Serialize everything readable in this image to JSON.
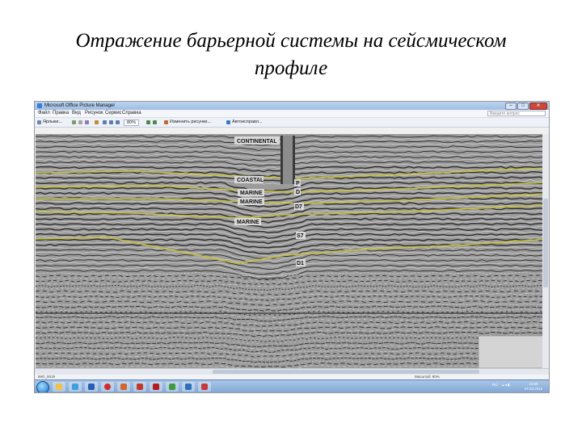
{
  "slide": {
    "title_line1": "Отражение барьерной системы на сейсмическом",
    "title_line2": "профиле"
  },
  "window": {
    "title": "Microsoft Office Picture Manager",
    "min": "–",
    "max": "□",
    "close": "✕"
  },
  "menu": {
    "items": [
      "Файл",
      "Правка",
      "Вид",
      "Рисунок",
      "Сервис",
      "Справка"
    ],
    "search_placeholder": "Введите вопрос"
  },
  "toolbar": {
    "shortcuts": "Ярлыки...",
    "zoom": "80%",
    "edit_pictures": "Изменить рисунки...",
    "autocorrect": "Автоисправл..."
  },
  "seismic": {
    "labels": {
      "continental": "CONTINENTAL",
      "coastal": "COASTAL",
      "marine1": "MARINE",
      "marine2": "MARINE",
      "marine3": "MARINE",
      "p": "P",
      "d": "D",
      "d7": "D7",
      "s7": "S7",
      "d1": "D1"
    },
    "colors": {
      "background": "#9c9c9c",
      "reflector_dark": "#2e2e2e",
      "reflector_light": "#d0d0d0",
      "horizon": "#c8c23a"
    }
  },
  "status": {
    "file_name": "IMG_0019",
    "zoom_text": "Масштаб: 80%"
  },
  "taskbar": {
    "lang": "RU",
    "time": "13:06",
    "date": "27.03.2015"
  }
}
